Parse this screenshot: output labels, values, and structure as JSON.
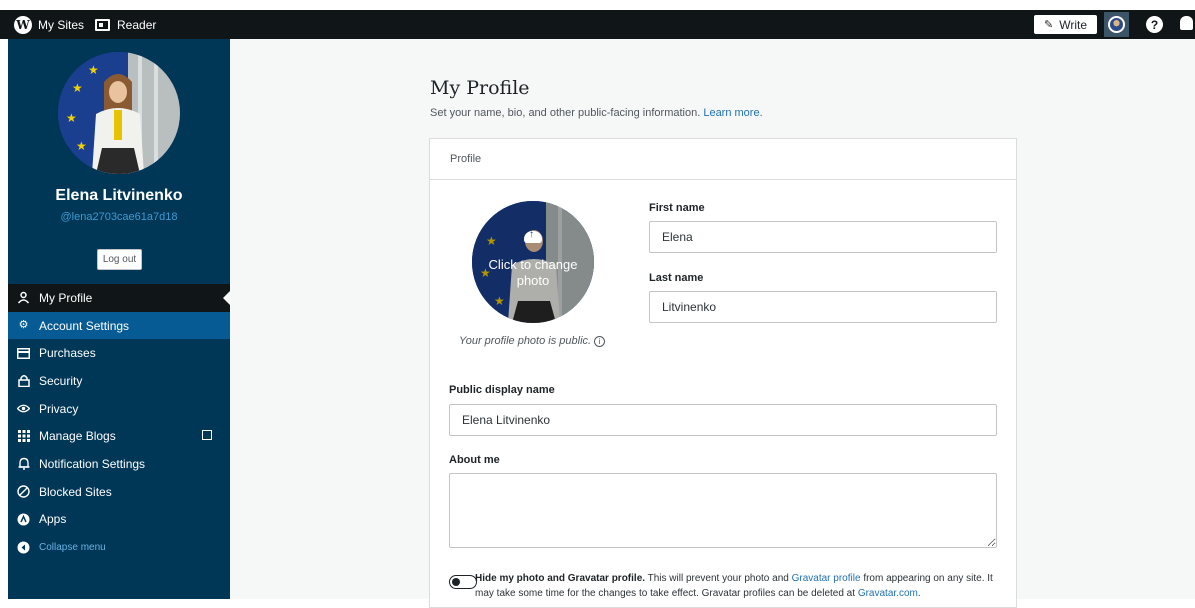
{
  "topbar": {
    "my_sites": "My Sites",
    "reader": "Reader",
    "write": "Write",
    "help": "?"
  },
  "sidebar": {
    "user_name": "Elena Litvinenko",
    "user_handle": "@lena2703cae61a7d18",
    "logout": "Log out",
    "items": [
      {
        "label": "My Profile",
        "icon": "person-icon",
        "state": "selected"
      },
      {
        "label": "Account Settings",
        "icon": "gear-icon",
        "state": "hover"
      },
      {
        "label": "Purchases",
        "icon": "credit-card-icon"
      },
      {
        "label": "Security",
        "icon": "lock-icon"
      },
      {
        "label": "Privacy",
        "icon": "eye-icon"
      },
      {
        "label": "Manage Blogs",
        "icon": "grid-icon"
      },
      {
        "label": "Notification Settings",
        "icon": "bell-icon"
      },
      {
        "label": "Blocked Sites",
        "icon": "blocked-icon"
      },
      {
        "label": "Apps",
        "icon": "apps-icon"
      },
      {
        "label": "Collapse menu",
        "icon": "collapse-arrow-icon"
      }
    ]
  },
  "main": {
    "title": "My Profile",
    "subtitle": "Set your name, bio, and other public-facing information.",
    "learn_more": "Learn more.",
    "card_header": "Profile",
    "photo_change": "Click to change photo",
    "photo_note": "Your profile photo is public.",
    "first_name_label": "First name",
    "first_name_value": "Elena",
    "last_name_label": "Last name",
    "last_name_value": "Litvinenko",
    "display_name_label": "Public display name",
    "display_name_value": "Elena Litvinenko",
    "about_label": "About me",
    "about_value": "",
    "hide_bold": "Hide my photo and Gravatar profile.",
    "hide_text_1": "This will prevent your photo and",
    "gravatar_profile_link": "Gravatar profile",
    "hide_text_2": "from appearing on any site. It may take some time for the changes to take effect. Gravatar profiles can be deleted at",
    "gravatar_com_link": "Gravatar.com",
    "hide_text_end": "."
  },
  "colors": {
    "sidebar_bg": "#003656",
    "topbar_bg": "#101517",
    "selected_bg": "#101517",
    "hover_bg": "#065b94",
    "link": "#2271b1"
  }
}
